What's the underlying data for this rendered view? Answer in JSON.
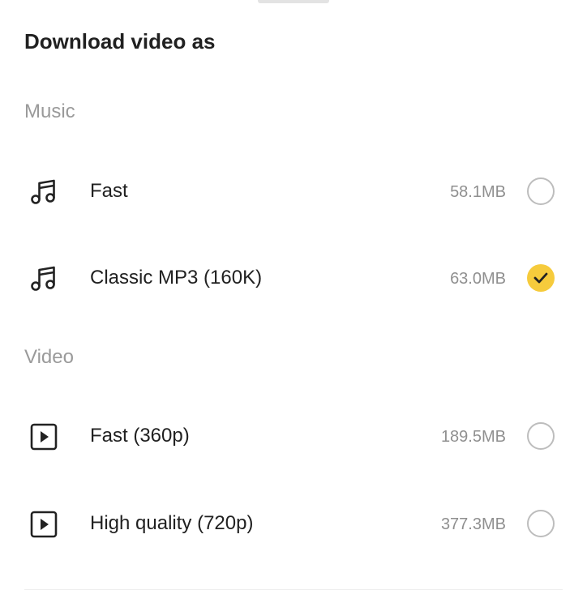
{
  "sheet": {
    "title": "Download video as"
  },
  "sections": {
    "music": {
      "header": "Music",
      "options": [
        {
          "label": "Fast",
          "size": "58.1MB",
          "icon": "music-note-icon",
          "selected": false
        },
        {
          "label": "Classic MP3 (160K)",
          "size": "63.0MB",
          "icon": "music-note-icon",
          "selected": true
        }
      ]
    },
    "video": {
      "header": "Video",
      "options": [
        {
          "label": "Fast (360p)",
          "size": "189.5MB",
          "icon": "play-video-icon",
          "selected": false
        },
        {
          "label": "High quality (720p)",
          "size": "377.3MB",
          "icon": "play-video-icon",
          "selected": false
        }
      ]
    }
  },
  "colors": {
    "accent": "#f6cb3c",
    "header_text": "#9a9a9a",
    "size_text": "#8f8f8f",
    "primary_text": "#212121",
    "radio_border": "#bdbdbd"
  }
}
